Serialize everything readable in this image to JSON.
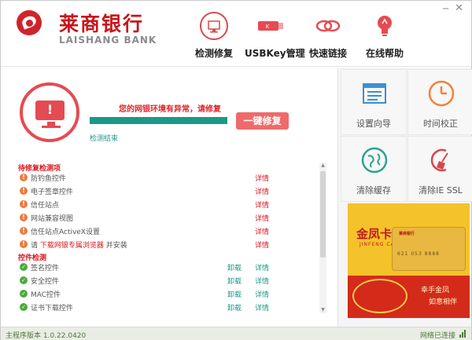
{
  "window": {
    "minimize": "─",
    "close": "✕"
  },
  "brand": {
    "cn": "莱商银行",
    "en": "LAISHANG BANK",
    "color": "#d0232b"
  },
  "nav": [
    {
      "label": "检测修复",
      "icon": "monitor-repair-icon"
    },
    {
      "label": "USBKey管理",
      "icon": "usbkey-icon"
    },
    {
      "label": "快速链接",
      "icon": "link-icon"
    },
    {
      "label": "在线帮助",
      "icon": "lightbulb-icon"
    }
  ],
  "detect": {
    "warning": "您的网银环境有异常，请修复",
    "progress": 1.0,
    "repair_button": "一键修复",
    "done": "检测结束"
  },
  "sections": [
    {
      "title": "待修复检测项",
      "items": [
        {
          "name": "防钓鱼控件",
          "status": "warn",
          "action2": "详情"
        },
        {
          "name": "电子签章控件",
          "status": "warn",
          "action2": "详情"
        },
        {
          "name": "信任站点",
          "status": "warn",
          "action2": "详情"
        },
        {
          "name": "网站兼容视图",
          "status": "warn",
          "action2": "详情"
        },
        {
          "name": "信任站点ActiveX设置",
          "status": "warn",
          "action2": "详情"
        },
        {
          "name_prefix": "请 ",
          "name_link": "下载网银专属浏览器",
          "name_suffix": " 并安装",
          "status": "warn",
          "action2": "详情"
        }
      ]
    },
    {
      "title": "控件检测",
      "items": [
        {
          "name": "签名控件",
          "status": "ok",
          "action1": "卸载",
          "action2": "详情"
        },
        {
          "name": "安全控件",
          "status": "ok",
          "action1": "卸载",
          "action2": "详情"
        },
        {
          "name": "MAC控件",
          "status": "ok",
          "action1": "卸载",
          "action2": "详情"
        },
        {
          "name": "证书下载控件",
          "status": "ok",
          "action1": "卸载",
          "action2": "详情"
        }
      ]
    }
  ],
  "tools": [
    {
      "label": "设置向导",
      "icon": "settings-wizard-icon"
    },
    {
      "label": "时间校正",
      "icon": "clock-icon"
    },
    {
      "label": "清除缓存",
      "icon": "globe-icon"
    },
    {
      "label": "清除IE SSL",
      "icon": "broom-icon"
    }
  ],
  "banner": {
    "title": "金凤卡",
    "subtitle": "JINFENG CARD",
    "bank": "莱商银行",
    "card_number": "621 053 8888",
    "slogan1": "幸手金凤",
    "slogan2": "如意相伴"
  },
  "status": {
    "version": "主程序版本 1.0.22.0420",
    "network": "网络已连接"
  }
}
